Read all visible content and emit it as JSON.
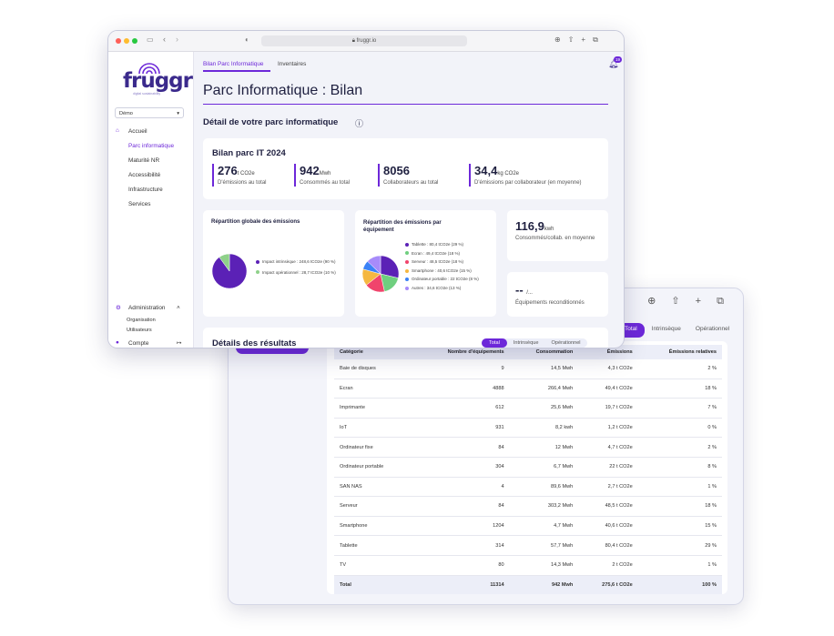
{
  "browser": {
    "url": "fruggr.io"
  },
  "brand": {
    "name": "fruggr",
    "tagline": "digital sustainability"
  },
  "sidebar": {
    "org_select": "Démo",
    "nav_home": "Accueil",
    "nav_items": [
      "Parc informatique",
      "Maturité NR",
      "Accessibilité",
      "Infrastructure",
      "Services"
    ],
    "admin": "Administration",
    "admin_items": [
      "Organisation",
      "Utilisateurs"
    ],
    "account": "Compte"
  },
  "header": {
    "tabs": [
      "Bilan Parc Informatique",
      "Inventaires"
    ],
    "notifications": "19",
    "page_title": "Parc Informatique : Bilan",
    "section_title": "Détail de votre parc informatique"
  },
  "summary": {
    "title": "Bilan parc IT 2024",
    "kpis": [
      {
        "value": "276",
        "unit": "t CO2e",
        "label": "D'émissions au total"
      },
      {
        "value": "942",
        "unit": "Mwh",
        "label": "Consommés au total"
      },
      {
        "value": "8056",
        "unit": "",
        "label": "Collaborateurs au total"
      },
      {
        "value": "34,4",
        "unit": "kg CO2e",
        "label": "D'émissions par collaborateur (en moyenne)"
      }
    ]
  },
  "global_chart": {
    "title": "Répartition globale des émissions",
    "legend": [
      {
        "label": "Impact intrinsèque : 248,6 tCO2e (90 %)",
        "color": "#5b21b6",
        "value": 90
      },
      {
        "label": "Impact opérationnel : 28,7 tCO2e (10 %)",
        "color": "#8fd18a",
        "value": 10
      }
    ]
  },
  "device_chart": {
    "title": "Répartition des émissions par équipement",
    "legend": [
      {
        "label": "Tablette : 80,4 tCO2e (29 %)",
        "color": "#5b21b6",
        "value": 29
      },
      {
        "label": "Ecran : 49,4 tCO2e (18 %)",
        "color": "#6fcf7f",
        "value": 18
      },
      {
        "label": "Serveur : 48,5 tCO2e (18 %)",
        "color": "#f0446c",
        "value": 18
      },
      {
        "label": "Smartphone : 40,6 tCO2e (15 %)",
        "color": "#f5b841",
        "value": 15
      },
      {
        "label": "Ordinateur portable : 22 tCO2e (8 %)",
        "color": "#3b82f6",
        "value": 8
      },
      {
        "label": "Autres : 34,6 tCO2e (13 %)",
        "color": "#a78bfa",
        "value": 13
      }
    ]
  },
  "side_kpis": [
    {
      "value": "116,9",
      "unit": "kwh",
      "label": "Consommés/collab. en moyenne"
    },
    {
      "value": "-- ",
      "unit": "/...",
      "label": "Équipements reconditionnés"
    }
  ],
  "results": {
    "title": "Détails des résultats",
    "tabs": [
      "Total",
      "Intrinsèque",
      "Opérationnel"
    ],
    "columns": [
      "Catégorie",
      "Nombre d'équipements",
      "Consommation",
      "Émissions",
      "Émissions relatives"
    ],
    "rows": [
      [
        "Baie de disques",
        "9",
        "14,5 Mwh",
        "4,3 t CO2e",
        "2 %"
      ],
      [
        "Ecran",
        "4888",
        "266,4 Mwh",
        "49,4 t CO2e",
        "18 %"
      ],
      [
        "Imprimante",
        "612",
        "25,6 Mwh",
        "19,7 t CO2e",
        "7 %"
      ],
      [
        "IoT",
        "931",
        "8,2 kwh",
        "1,2 t CO2e",
        "0 %"
      ],
      [
        "Ordinateur fixe",
        "84",
        "12 Mwh",
        "4,7 t CO2e",
        "2 %"
      ],
      [
        "Ordinateur portable",
        "304",
        "6,7 Mwh",
        "22 t CO2e",
        "8 %"
      ],
      [
        "SAN NAS",
        "4",
        "89,6 Mwh",
        "2,7 t CO2e",
        "1 %"
      ],
      [
        "Serveur",
        "84",
        "303,2 Mwh",
        "48,5 t CO2e",
        "18 %"
      ],
      [
        "Smartphone",
        "1204",
        "4,7 Mwh",
        "40,6 t CO2e",
        "15 %"
      ],
      [
        "Tablette",
        "314",
        "57,7 Mwh",
        "80,4 t CO2e",
        "29 %"
      ],
      [
        "TV",
        "80",
        "14,3 Mwh",
        "2 t CO2e",
        "1 %"
      ]
    ],
    "total": [
      "Total",
      "11314",
      "942 Mwh",
      "275,6 t CO2e",
      "100 %"
    ]
  },
  "colors": {
    "accent": "#6d28d9",
    "brand": "#3b2a8c"
  }
}
